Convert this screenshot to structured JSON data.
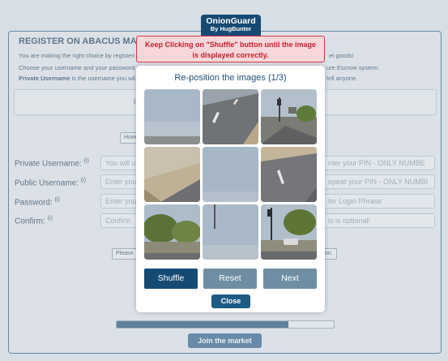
{
  "badge": {
    "title": "OnionGuard",
    "subtitle": "By HugBunter"
  },
  "warning": "Keep Clicking on \"Shuffle\" button until the image is displayed correctly.",
  "captcha": {
    "title": "Re-position the images (1/3)",
    "tiles": [
      "sky-top-left",
      "road-top-center",
      "street-top-right",
      "hill-mid-left",
      "sky-center",
      "road-mid-right",
      "trees-bottom-left",
      "sky-bottom-center",
      "intersection-bottom-right"
    ],
    "shuffle_label": "Shuffle",
    "reset_label": "Reset",
    "next_label": "Next",
    "close_label": "Close"
  },
  "background": {
    "title": "REGISTER ON ABACUS MARKET",
    "line1_left": "You are making the right choice by registeri",
    "line1_right": "et goods!",
    "line2_left": "Choose your username and your password ar",
    "line2_right": "ure Escrow system.",
    "line3_left": "Private Username",
    "line3_mid": " is the username you wil",
    "line3_right": "tell anyone.",
    "info_fragment": "I",
    "small_button_1": "Howe",
    "small_button_2": "Please",
    "small_button_2_right": "on.",
    "fields": [
      {
        "label": "Private Username:",
        "sup": "(i)",
        "left_placeholder": "You will u",
        "right_placeholder": "nter your PIN - ONLY NUMBE"
      },
      {
        "label": "Public Username:",
        "sup": "(i)",
        "left_placeholder": "Enter you",
        "right_placeholder": "epeat your PIN - ONLY NUMBI"
      },
      {
        "label": "Password:",
        "sup": "(i)",
        "left_placeholder": "Enter you",
        "right_placeholder": "ter Login Phrase"
      },
      {
        "label": "Confirm:",
        "sup": "(i)",
        "left_placeholder": "Confirm",
        "right_placeholder": "is is optional!"
      }
    ],
    "progress_fraction": 0.79,
    "join_label": "Join the market"
  },
  "colors": {
    "primary": "#164a73",
    "warning_text": "#c5212f",
    "warning_bg": "#f8d7da"
  }
}
